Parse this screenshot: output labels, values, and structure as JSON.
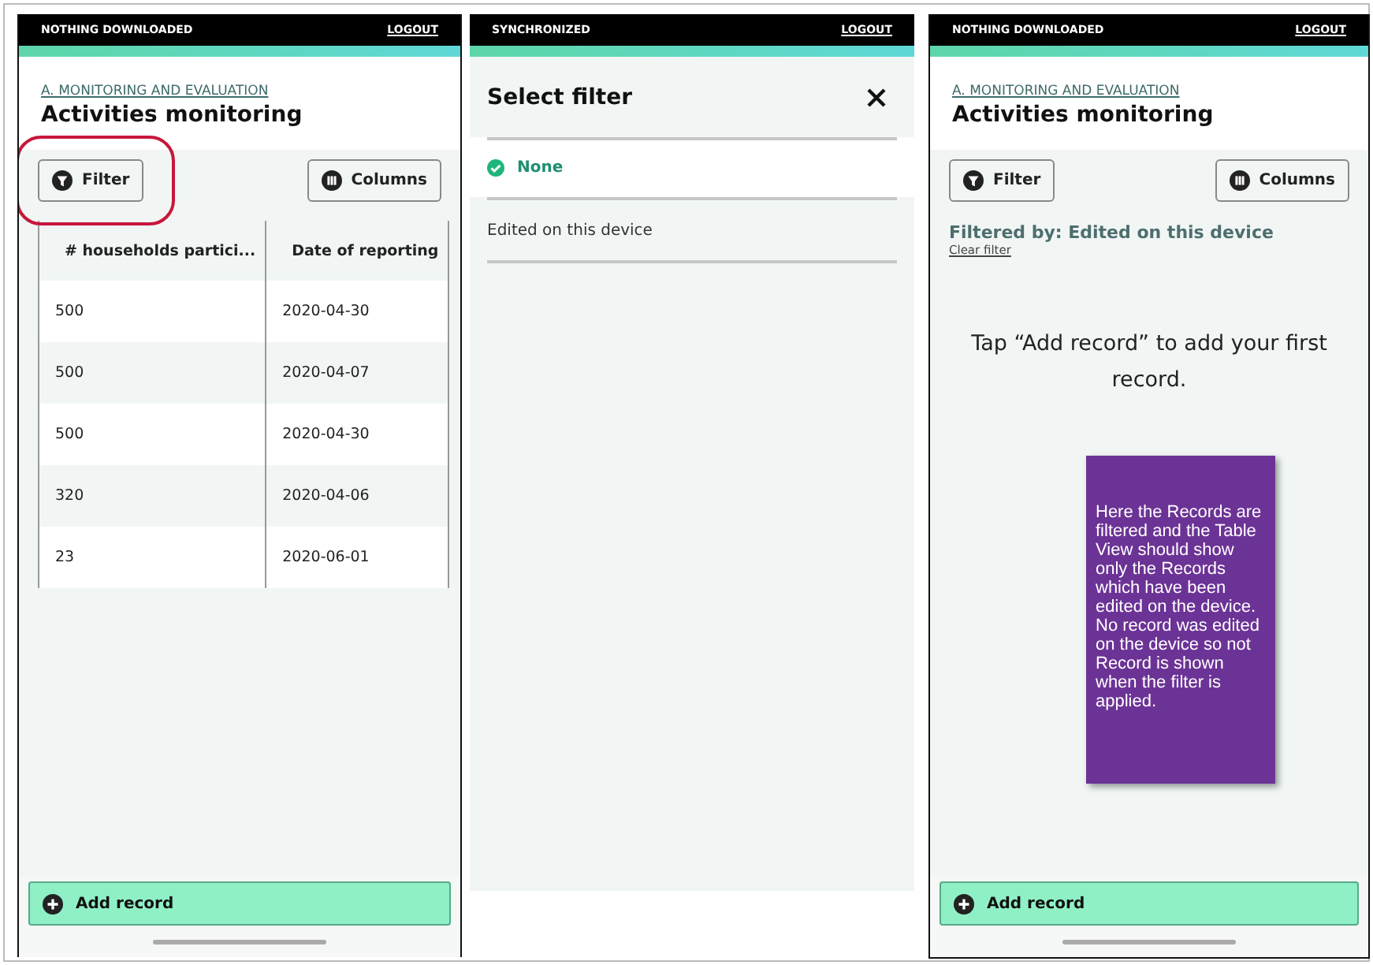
{
  "screens": [
    {
      "kind": "table",
      "status": "NOTHING DOWNLOADED",
      "logout": "LOGOUT",
      "breadcrumb": "A. MONITORING AND EVALUATION",
      "title": "Activities monitoring",
      "filter_button": "Filter",
      "filter_highlighted": true,
      "columns_button": "Columns",
      "table": {
        "columns": [
          "# households partici...",
          "Date of reporting"
        ],
        "rows": [
          [
            "500",
            "2020-04-30"
          ],
          [
            "500",
            "2020-04-07"
          ],
          [
            "500",
            "2020-04-30"
          ],
          [
            "320",
            "2020-04-06"
          ],
          [
            "23",
            "2020-06-01"
          ]
        ]
      },
      "add_record": "Add record"
    },
    {
      "kind": "filter",
      "status": "SYNCHRONIZED",
      "logout": "LOGOUT",
      "title": "Select filter",
      "options": [
        {
          "label": "None",
          "selected": true
        },
        {
          "label": "Edited on this device",
          "selected": false
        }
      ]
    },
    {
      "kind": "empty",
      "status": "NOTHING DOWNLOADED",
      "logout": "LOGOUT",
      "breadcrumb": "A. MONITORING AND EVALUATION",
      "title": "Activities monitoring",
      "filter_button": "Filter",
      "filter_highlighted": false,
      "columns_button": "Columns",
      "filtered_by": "Filtered by: Edited on this device",
      "clear_filter": "Clear filter",
      "empty_message": "Tap “Add record” to add your first record.",
      "note": "Here the Records are filtered and the Table View should show only the Records which have been edited on the device. No record was edited on the device so not Record is shown when the filter is applied.",
      "add_record": "Add record"
    }
  ]
}
